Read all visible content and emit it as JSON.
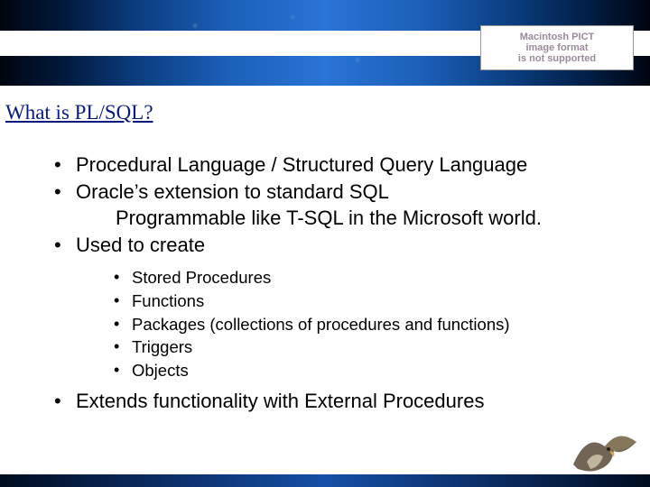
{
  "pict": {
    "line1": "Macintosh PICT",
    "line2": "image format",
    "line3": "is not supported"
  },
  "title": "What is PL/SQL?",
  "bullets": {
    "b1": "Procedural Language / Structured Query Language",
    "b2": "Oracle’s extension to standard SQL",
    "b2sub": "Programmable like T-SQL in the Microsoft world.",
    "b3": "Used to create",
    "sub1": "Stored Procedures",
    "sub2": "Functions",
    "sub3": "Packages (collections of procedures and functions)",
    "sub4": "Triggers",
    "sub5": "Objects",
    "b4": "Extends functionality with External Procedures"
  }
}
